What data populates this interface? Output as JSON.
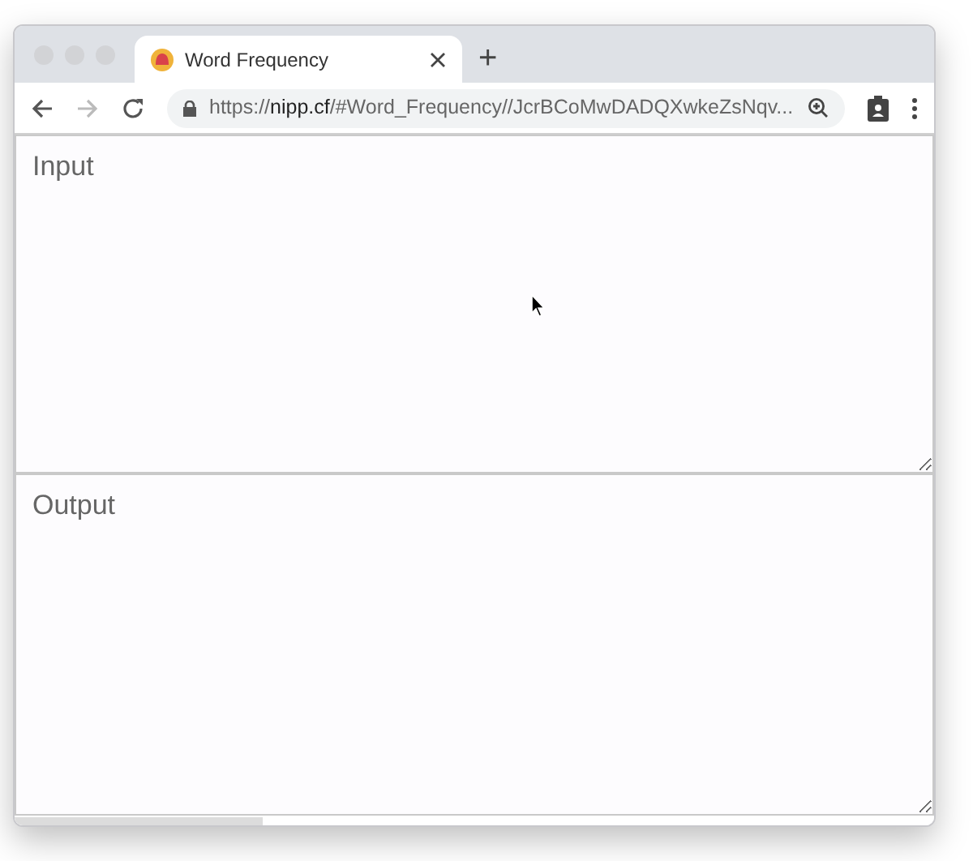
{
  "window": {
    "tab_title": "Word Frequency",
    "new_tab": "+"
  },
  "address_bar": {
    "scheme": "https://",
    "host": "nipp.cf",
    "path": "/#Word_Frequency//JcrBCoMwDADQXwkeZsNqv..."
  },
  "nav": {
    "back_enabled": true,
    "forward_enabled": false
  },
  "input": {
    "placeholder": "Input"
  },
  "output": {
    "placeholder": "Output"
  }
}
